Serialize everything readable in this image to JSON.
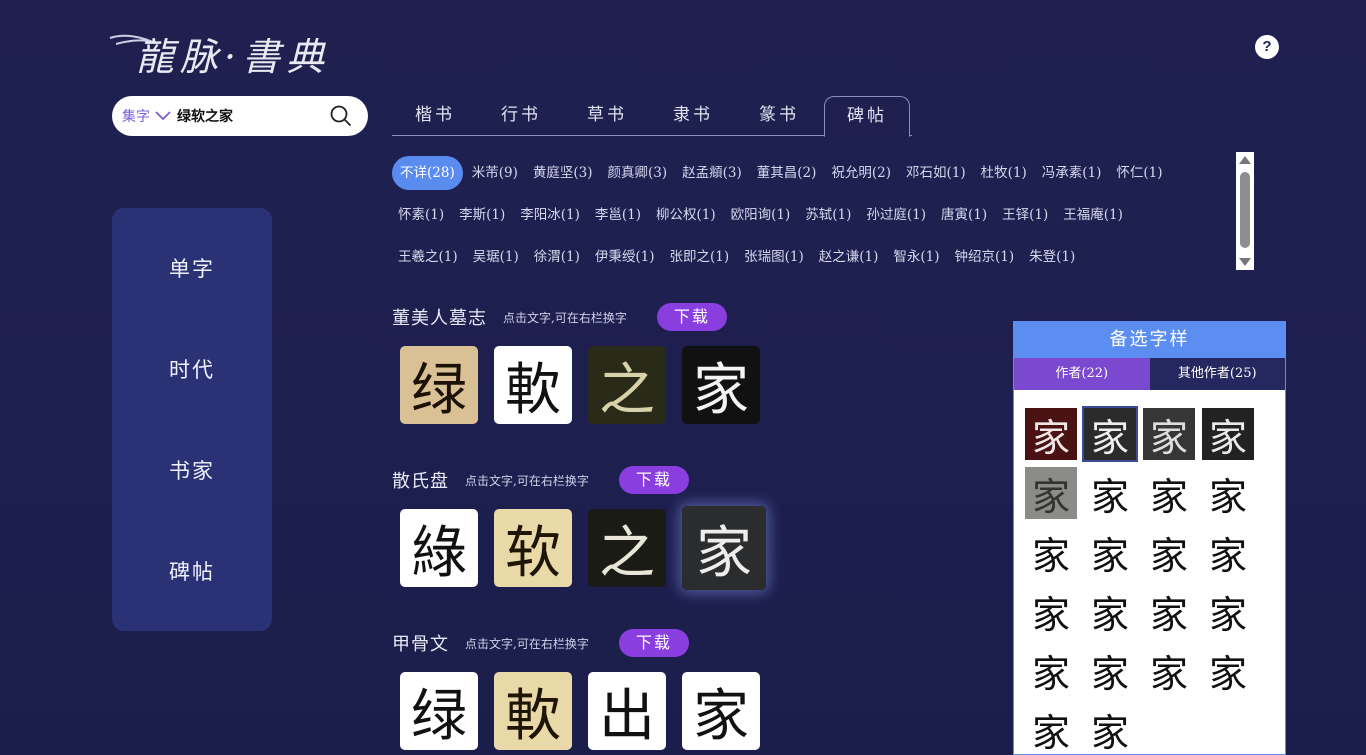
{
  "header": {
    "logo_text": "龍脉·書典",
    "help_label": "?"
  },
  "search": {
    "mode_label": "集字",
    "value": "绿软之家"
  },
  "side_nav": [
    {
      "label": "单字"
    },
    {
      "label": "时代"
    },
    {
      "label": "书家"
    },
    {
      "label": "碑帖"
    }
  ],
  "tabs": [
    {
      "label": "楷书",
      "active": false
    },
    {
      "label": "行书",
      "active": false
    },
    {
      "label": "草书",
      "active": false
    },
    {
      "label": "隶书",
      "active": false
    },
    {
      "label": "篆书",
      "active": false
    },
    {
      "label": "碑帖",
      "active": true
    }
  ],
  "author_filter": {
    "rows": [
      [
        "不详(28)",
        "米芾(9)",
        "黄庭坚(3)",
        "颜真卿(3)",
        "赵孟頫(3)",
        "董其昌(2)",
        "祝允明(2)",
        "邓石如(1)",
        "杜牧(1)",
        "冯承素(1)",
        "怀仁(1)"
      ],
      [
        "怀素(1)",
        "李斯(1)",
        "李阳冰(1)",
        "李邕(1)",
        "柳公权(1)",
        "欧阳询(1)",
        "苏轼(1)",
        "孙过庭(1)",
        "唐寅(1)",
        "王铎(1)",
        "王福庵(1)"
      ],
      [
        "王羲之(1)",
        "吴琚(1)",
        "徐渭(1)",
        "伊秉绶(1)",
        "张即之(1)",
        "张瑞图(1)",
        "赵之谦(1)",
        "智永(1)",
        "钟绍京(1)",
        "朱登(1)"
      ]
    ],
    "active": "不详(28)"
  },
  "results": [
    {
      "title": "董美人墓志",
      "hint": "点击文字,可在右栏换字",
      "download_label": "下载",
      "glyphs": [
        {
          "char": "绿",
          "style": "g-tan"
        },
        {
          "char": "軟",
          "style": "g-white"
        },
        {
          "char": "之",
          "style": "g-darkgold"
        },
        {
          "char": "家",
          "style": "g-black"
        }
      ]
    },
    {
      "title": "散氏盘",
      "hint": "点击文字,可在右栏换字",
      "download_label": "下载",
      "glyphs": [
        {
          "char": "綠",
          "style": "g-white"
        },
        {
          "char": "软",
          "style": "g-cream"
        },
        {
          "char": "之",
          "style": "g-dark"
        },
        {
          "char": "家",
          "style": "g-selected"
        }
      ]
    },
    {
      "title": "甲骨文",
      "hint": "点击文字,可在右栏换字",
      "download_label": "下载",
      "glyphs": [
        {
          "char": "绿",
          "style": "g-white"
        },
        {
          "char": "軟",
          "style": "g-cream"
        },
        {
          "char": "出",
          "style": "g-white"
        },
        {
          "char": "家",
          "style": "g-white"
        }
      ]
    }
  ],
  "candidates": {
    "title": "备选字样",
    "tabs": [
      {
        "label": "作者(22)",
        "active": true
      },
      {
        "label": "其他作者(25)",
        "active": false
      }
    ],
    "items": [
      {
        "char": "家",
        "style": "c-red"
      },
      {
        "char": "家",
        "style": "c-selected"
      },
      {
        "char": "家",
        "style": "c-darkgrey"
      },
      {
        "char": "家",
        "style": "c-dark"
      },
      {
        "char": "家",
        "style": "c-mottled"
      },
      {
        "char": "家",
        "style": ""
      },
      {
        "char": "家",
        "style": ""
      },
      {
        "char": "家",
        "style": ""
      },
      {
        "char": "家",
        "style": ""
      },
      {
        "char": "家",
        "style": ""
      },
      {
        "char": "家",
        "style": ""
      },
      {
        "char": "家",
        "style": ""
      },
      {
        "char": "家",
        "style": ""
      },
      {
        "char": "家",
        "style": ""
      },
      {
        "char": "家",
        "style": ""
      },
      {
        "char": "家",
        "style": ""
      },
      {
        "char": "家",
        "style": ""
      },
      {
        "char": "家",
        "style": ""
      },
      {
        "char": "家",
        "style": ""
      },
      {
        "char": "家",
        "style": ""
      },
      {
        "char": "家",
        "style": ""
      },
      {
        "char": "家",
        "style": ""
      }
    ]
  },
  "colors": {
    "background": "#1f2050",
    "sidebar": "#2a3275",
    "accent_blue": "#5b8ef0",
    "accent_purple": "#8a3ee0"
  }
}
